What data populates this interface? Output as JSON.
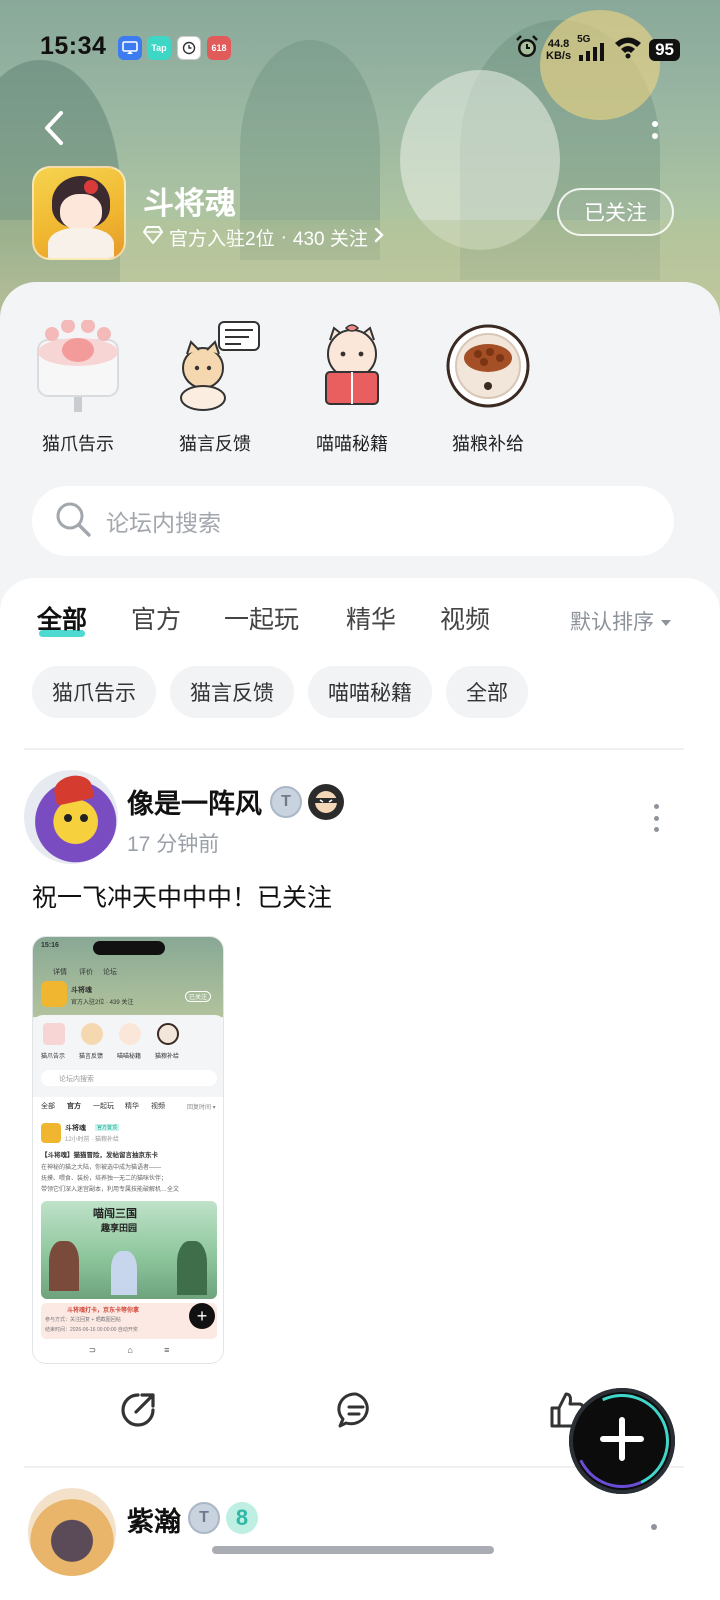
{
  "status_bar": {
    "time": "15:34",
    "apps": [
      {
        "icon": "screen-cast-icon",
        "label": "",
        "color": "#3d7cf0"
      },
      {
        "icon": "taptap-icon",
        "label": "Tap",
        "color": "#3ed6c4"
      },
      {
        "icon": "clock-app-icon",
        "label": "",
        "color": "#ffffff"
      },
      {
        "icon": "game-app-icon",
        "label": "618",
        "color": "#e25b5b"
      }
    ],
    "net_speed_value": "44.8",
    "net_speed_unit": "KB/s",
    "network": "5G",
    "battery": "95"
  },
  "header": {
    "title": "斗将魂",
    "meta_official": "官方入驻2位",
    "meta_separator": "·",
    "meta_follows": "430 关注",
    "follow_label": "已关注"
  },
  "shortcuts": [
    {
      "label": "猫爪告示",
      "icon": "cat-paw-notice-icon"
    },
    {
      "label": "猫言反馈",
      "icon": "cat-feedback-icon"
    },
    {
      "label": "喵喵秘籍",
      "icon": "cat-guide-book-icon"
    },
    {
      "label": "猫粮补给",
      "icon": "cat-food-bowl-icon"
    }
  ],
  "search": {
    "placeholder": "论坛内搜索"
  },
  "tabs": [
    {
      "label": "全部",
      "active": true
    },
    {
      "label": "官方",
      "active": false
    },
    {
      "label": "一起玩",
      "active": false
    },
    {
      "label": "精华",
      "active": false
    },
    {
      "label": "视频",
      "active": false
    }
  ],
  "sort_label": "默认排序",
  "filter_chips": [
    "猫爪告示",
    "猫言反馈",
    "喵喵秘籍",
    "全部"
  ],
  "posts": [
    {
      "author": "像是一阵风",
      "level_badge": "T",
      "time": "17 分钟前",
      "text": "祝一飞冲天中中中！已关注",
      "image": {
        "time": "15:16",
        "nav": [
          "详情",
          "评价",
          "论坛"
        ],
        "title": "斗将魂",
        "meta": "官方入驻2位 · 439 关注",
        "follow": "已关注",
        "shortcuts": [
          "猫爪告示",
          "猫言反馈",
          "喵喵秘籍",
          "猫粮补给"
        ],
        "search": "论坛内搜索",
        "tabs": [
          "全部",
          "官方",
          "一起玩",
          "精华",
          "视频"
        ],
        "sort": "回复时间 ▾",
        "post_author": "斗将魂",
        "post_badge": "官方置顶",
        "post_time": "12小时前 · 猫粮补给",
        "post_title": "【斗将魂】猫猫冒险，发帖留言抽京东卡",
        "post_lines": [
          "在神秘的猫之大陆，你被选中成为猫语者——",
          "抚摸、喂食、装扮，培养独一无二的猫咪伙伴；",
          "带领它们深入迷宫副本，利用专属技能破解机…全文"
        ],
        "banner_title": "喵闯三国",
        "banner_subtitle": "趣享田园",
        "promo_title": "斗将魂打卡，京东卡等你拿",
        "promo_line1": "参与方式：关注回复 + 晒截图回帖",
        "promo_line2": "结束时间：2026-06-16 00:00:00 自动开奖"
      }
    },
    {
      "author": "紫瀚",
      "level_badge": "T",
      "extra_badge": "8"
    }
  ],
  "actions": [
    {
      "icon": "share-icon"
    },
    {
      "icon": "comment-icon"
    },
    {
      "icon": "like-icon"
    }
  ],
  "fab": {
    "icon": "plus-icon"
  }
}
